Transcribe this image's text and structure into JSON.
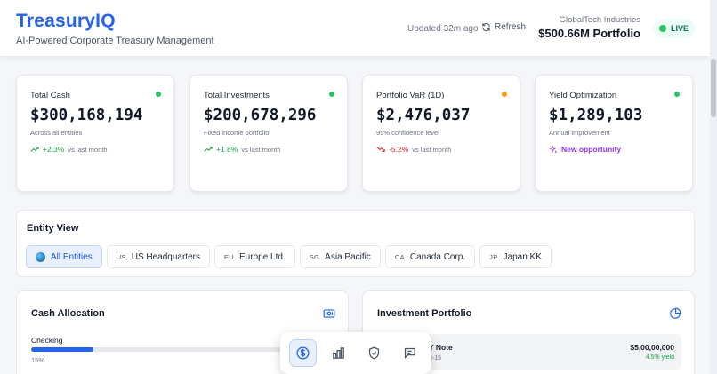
{
  "header": {
    "brand": "TreasuryIQ",
    "tagline": "AI-Powered Corporate Treasury Management",
    "updated": "Updated 32m ago",
    "refresh_label": "Refresh",
    "company": "GlobalTech Industries",
    "portfolio": "$500.66M Portfolio",
    "live_label": "LIVE"
  },
  "metrics": [
    {
      "label": "Total Cash",
      "value": "$300,168,194",
      "sub": "Across all entities",
      "trend": "+2.3%",
      "vs": "vs last month",
      "status_color": "#22c55e",
      "trend_color": "#16a34a"
    },
    {
      "label": "Total Investments",
      "value": "$200,678,296",
      "sub": "Fixed income portfolio",
      "trend": "+1.8%",
      "vs": "vs last month",
      "status_color": "#22c55e",
      "trend_color": "#16a34a"
    },
    {
      "label": "Portfolio VaR (1D)",
      "value": "$2,476,037",
      "sub": "95% confidence level",
      "trend": "-5.2%",
      "vs": "vs last month",
      "status_color": "#f59e0b",
      "trend_color": "#dc2626"
    },
    {
      "label": "Yield Optimization",
      "value": "$1,289,103",
      "sub": "Annual improvement",
      "trend": "New opportunity",
      "vs": "",
      "status_color": "#22c55e",
      "trend_color": "#9333ea"
    }
  ],
  "entity_view": {
    "title": "Entity View",
    "chips": [
      {
        "code": "",
        "label": "All Entities",
        "icon": "globe-icon"
      },
      {
        "code": "US",
        "label": "US Headquarters"
      },
      {
        "code": "EU",
        "label": "Europe Ltd."
      },
      {
        "code": "SG",
        "label": "Asia Pacific"
      },
      {
        "code": "CA",
        "label": "Canada Corp."
      },
      {
        "code": "JP",
        "label": "Japan KK"
      }
    ]
  },
  "cash_allocation": {
    "title": "Cash Allocation",
    "icon": "banknote-icon",
    "items": [
      {
        "label": "Checking",
        "percent": 15,
        "percent_label": "15%"
      }
    ]
  },
  "investment_portfolio": {
    "title": "Investment Portfolio",
    "icon": "pie-chart-icon",
    "items": [
      {
        "name": "Y Note",
        "date": "3-15",
        "amount": "$5,00,00,000",
        "yield": "4.5% yield"
      }
    ]
  },
  "toolbar": {
    "buttons": [
      "dollar-icon",
      "bar-chart-icon",
      "shield-icon",
      "chat-icon"
    ]
  },
  "colors": {
    "accent": "#2563eb",
    "positive": "#16a34a",
    "negative": "#dc2626",
    "warning": "#f59e0b",
    "opportunity": "#9333ea"
  }
}
